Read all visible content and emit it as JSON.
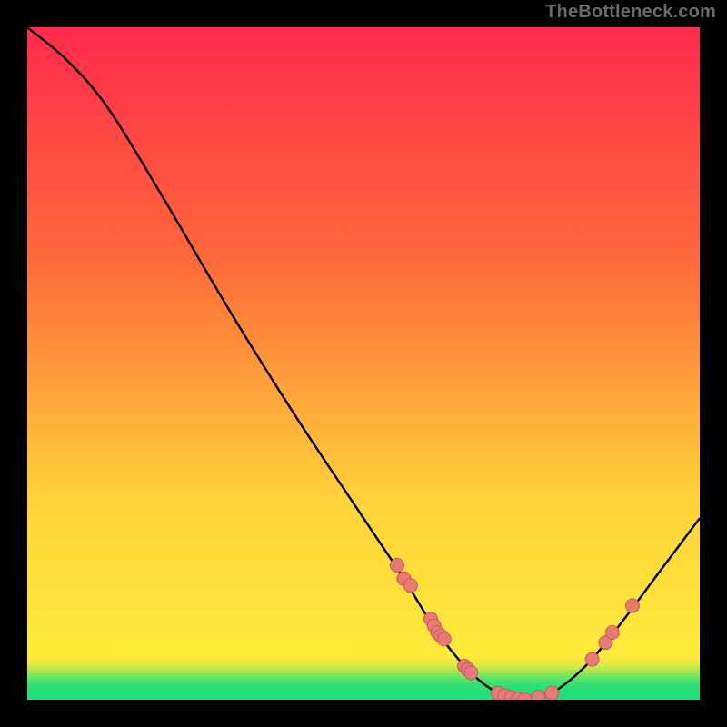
{
  "attribution": "TheBottleneck.com",
  "chart_data": {
    "type": "line",
    "title": "",
    "xlabel": "",
    "ylabel": "",
    "xlim": [
      0,
      100
    ],
    "ylim": [
      0,
      100
    ],
    "grid": false,
    "legend": false,
    "curve": [
      {
        "x": 0,
        "y": 100
      },
      {
        "x": 6,
        "y": 95
      },
      {
        "x": 12,
        "y": 88
      },
      {
        "x": 20,
        "y": 75
      },
      {
        "x": 30,
        "y": 58
      },
      {
        "x": 40,
        "y": 42
      },
      {
        "x": 50,
        "y": 27
      },
      {
        "x": 56,
        "y": 18
      },
      {
        "x": 61,
        "y": 10
      },
      {
        "x": 66,
        "y": 4
      },
      {
        "x": 70,
        "y": 1
      },
      {
        "x": 74,
        "y": 0
      },
      {
        "x": 78,
        "y": 1
      },
      {
        "x": 83,
        "y": 5
      },
      {
        "x": 88,
        "y": 11
      },
      {
        "x": 94,
        "y": 19
      },
      {
        "x": 100,
        "y": 27
      }
    ],
    "markers": [
      {
        "x": 55,
        "y": 20
      },
      {
        "x": 56,
        "y": 18
      },
      {
        "x": 57,
        "y": 17
      },
      {
        "x": 60,
        "y": 12
      },
      {
        "x": 60.5,
        "y": 11
      },
      {
        "x": 61,
        "y": 10
      },
      {
        "x": 61.5,
        "y": 9.5
      },
      {
        "x": 62,
        "y": 9
      },
      {
        "x": 65,
        "y": 5
      },
      {
        "x": 65.5,
        "y": 4.5
      },
      {
        "x": 66,
        "y": 4
      },
      {
        "x": 70,
        "y": 1
      },
      {
        "x": 71,
        "y": 0.6
      },
      {
        "x": 72,
        "y": 0.3
      },
      {
        "x": 73,
        "y": 0.1
      },
      {
        "x": 74,
        "y": 0
      },
      {
        "x": 76,
        "y": 0.4
      },
      {
        "x": 78,
        "y": 1
      },
      {
        "x": 84,
        "y": 6
      },
      {
        "x": 86,
        "y": 8.5
      },
      {
        "x": 87,
        "y": 10
      },
      {
        "x": 90,
        "y": 14
      }
    ],
    "green_band": {
      "y_from": 0,
      "y_to": 6
    },
    "colors": {
      "background_gradient_top": "#ff2a4d",
      "background_gradient_mid1": "#ff6a3a",
      "background_gradient_mid2": "#ffd23a",
      "background_gradient_bottom": "#fff23a",
      "curve": "#000000",
      "marker_fill": "#e77a78",
      "marker_stroke": "#c85a58",
      "green": "#1fe07a"
    }
  }
}
